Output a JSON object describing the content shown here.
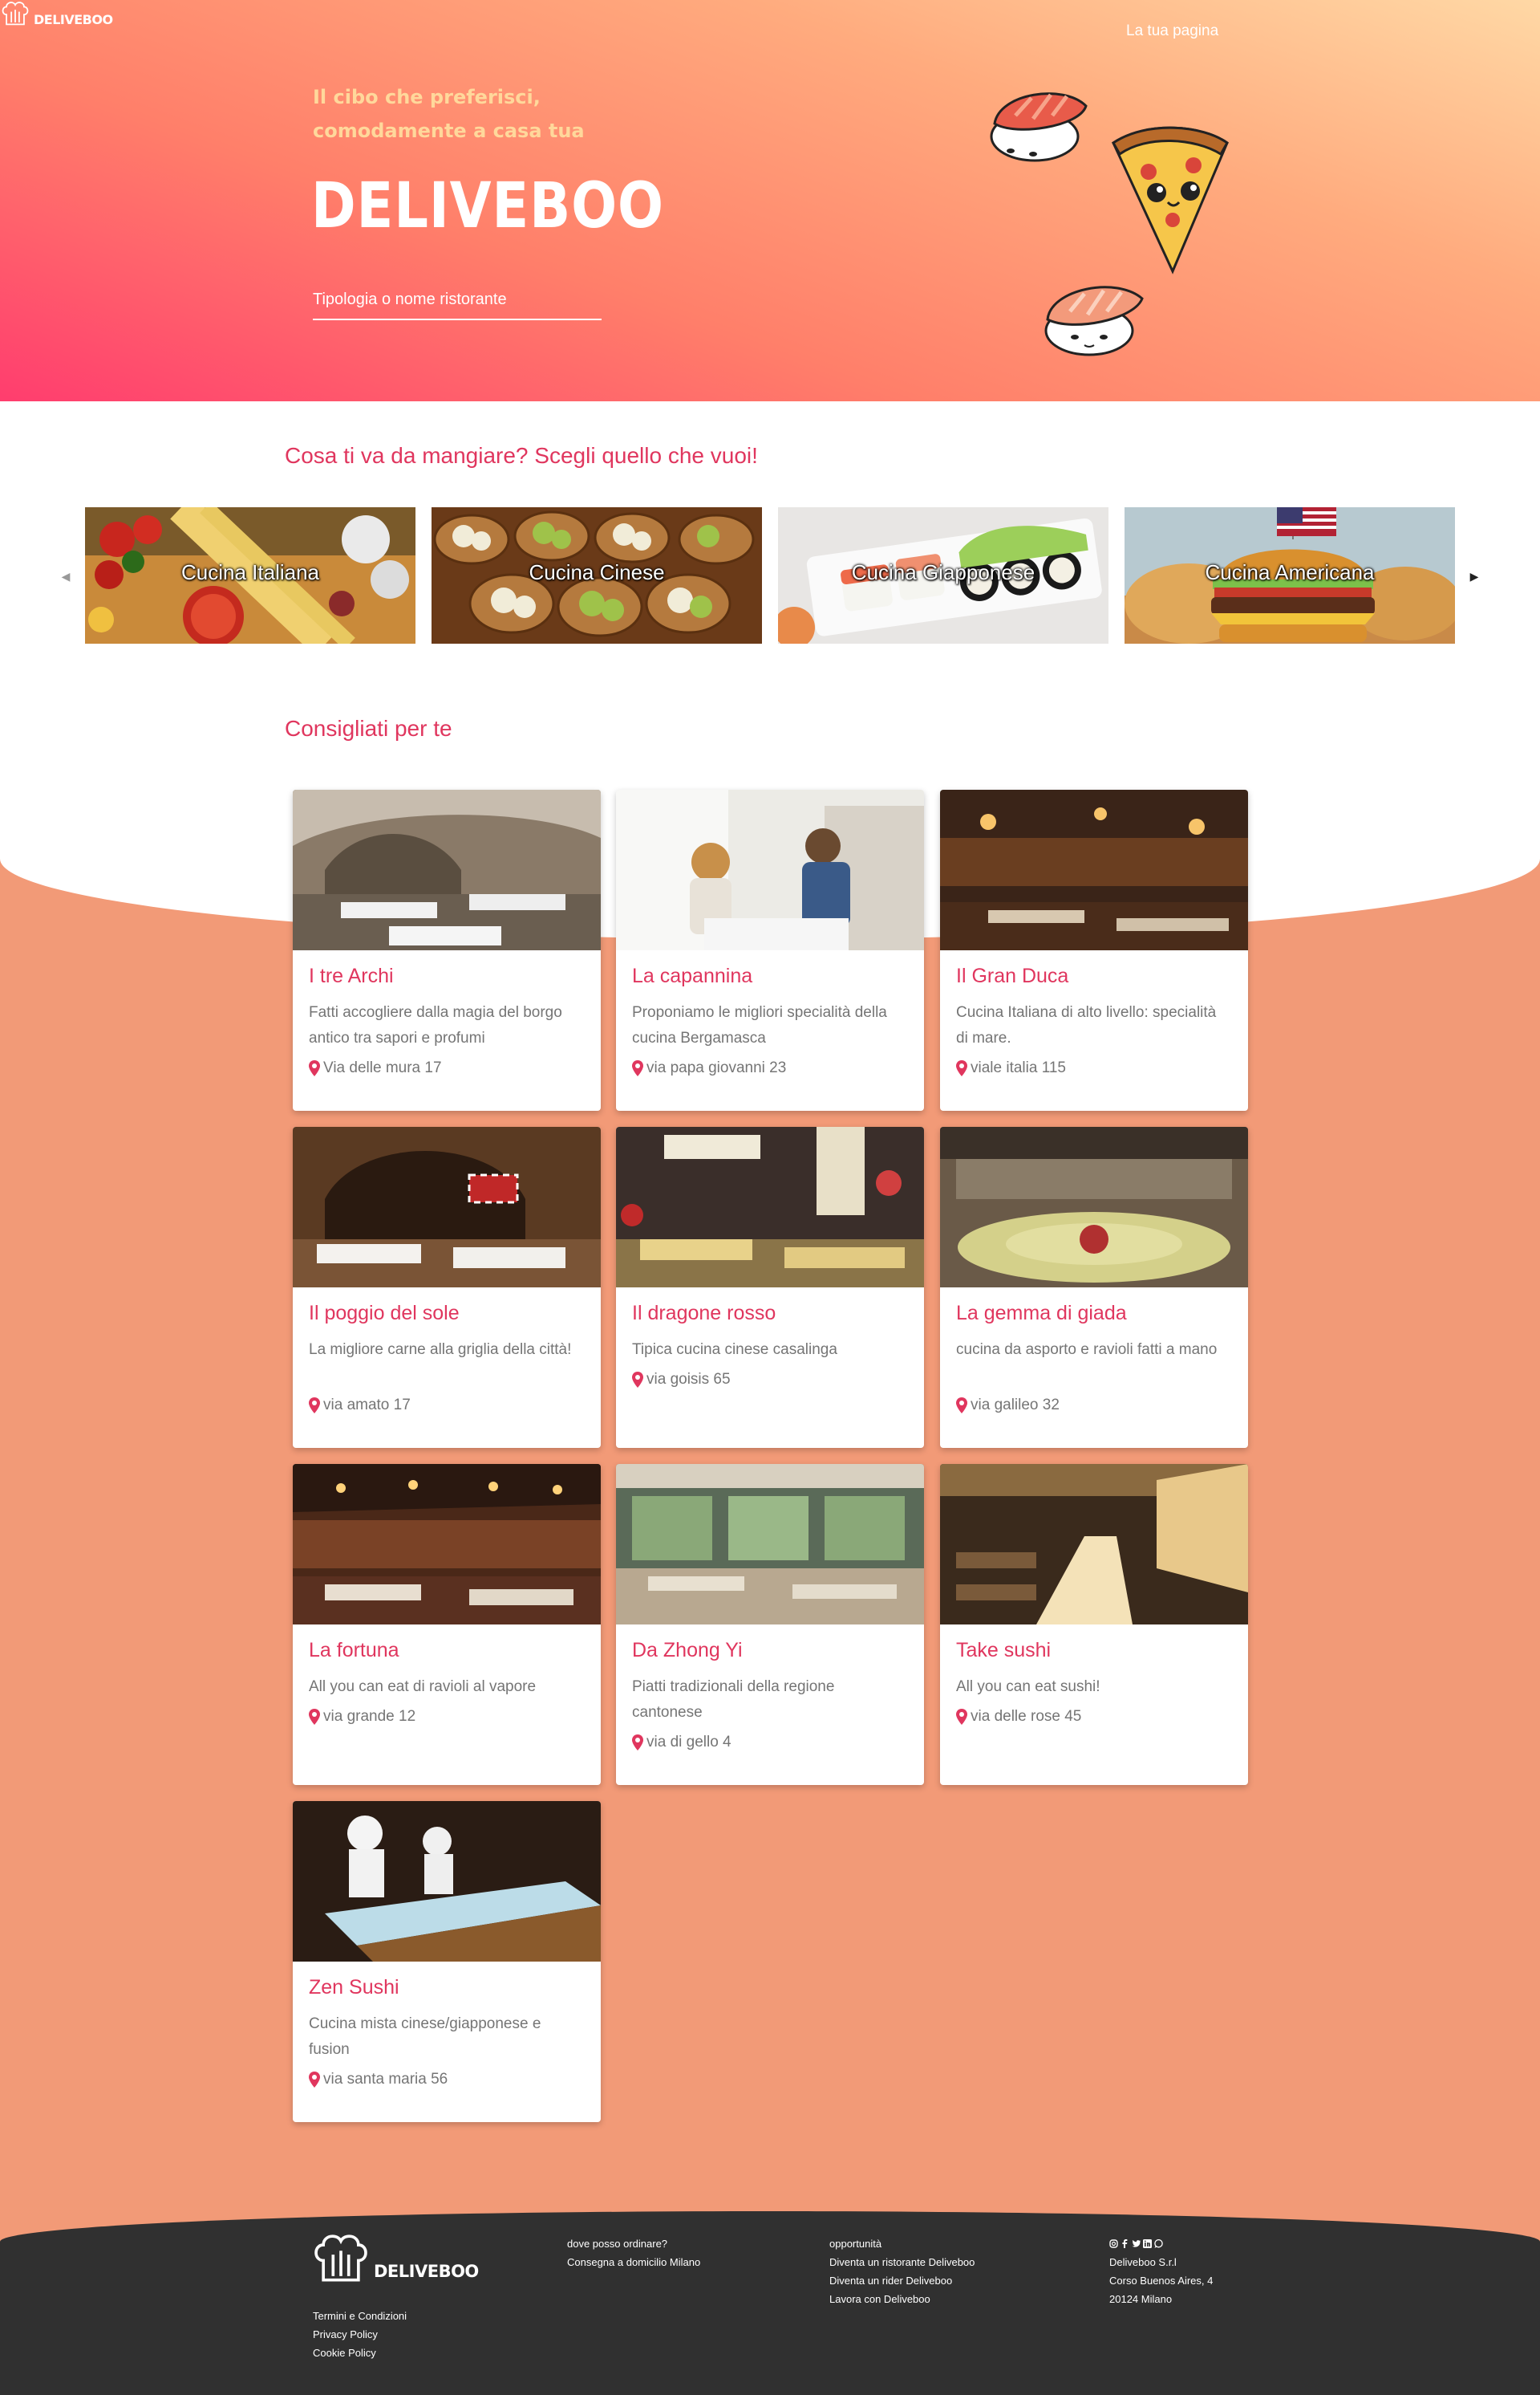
{
  "header": {
    "logo_text": "DELIVEBOO",
    "tagline": "Il cibo che preferisci, comodamente a casa tua",
    "title": "DELIVEBOO",
    "nav_link": "La tua pagina",
    "search_placeholder": "Tipologia o nome ristorante"
  },
  "sections": {
    "categories_title": "Cosa ti va da mangiare? Scegli quello che vuoi!",
    "recommended_title": "Consigliati per te"
  },
  "categories": [
    {
      "label": "Cucina Italiana"
    },
    {
      "label": "Cucina Cinese"
    },
    {
      "label": "Cucina Giapponese"
    },
    {
      "label": "Cucina Americana"
    }
  ],
  "restaurants": [
    {
      "name": "I tre Archi",
      "description": "Fatti accogliere dalla magia del borgo antico tra sapori e profumi",
      "address": "Via delle mura 17"
    },
    {
      "name": "La capannina",
      "description": "Proponiamo le migliori specialità della cucina Bergamasca",
      "address": "via papa giovanni 23"
    },
    {
      "name": "Il Gran Duca",
      "description": "Cucina Italiana di alto livello: specialità di mare.",
      "address": "viale italia 115"
    },
    {
      "name": "Il poggio del sole",
      "description": "La migliore carne alla griglia della città!",
      "address": "via amato 17"
    },
    {
      "name": "Il dragone rosso",
      "description": "Tipica cucina cinese casalinga",
      "address": "via goisis 65"
    },
    {
      "name": "La gemma di giada",
      "description": "cucina da asporto e ravioli fatti a mano",
      "address": "via galileo 32"
    },
    {
      "name": "La fortuna",
      "description": "All you can eat di ravioli al vapore",
      "address": "via grande 12"
    },
    {
      "name": "Da Zhong Yi",
      "description": "Piatti tradizionali della regione cantonese",
      "address": "via di gello 4"
    },
    {
      "name": "Take sushi",
      "description": "All you can eat sushi!",
      "address": "via delle rose 45"
    },
    {
      "name": "Zen Sushi",
      "description": "Cucina mista cinese/giapponese e fusion",
      "address": "via santa maria 56"
    }
  ],
  "footer": {
    "logo_text": "DELIVEBOO",
    "links": [
      "Termini e Condizioni",
      "Privacy Policy",
      "Cookie Policy"
    ],
    "col1": {
      "title": "dove posso ordinare?",
      "items": [
        "Consegna a domicilio Milano"
      ]
    },
    "col2": {
      "title": "opportunità",
      "items": [
        "Diventa un ristorante Deliveboo",
        "Diventa un rider Deliveboo",
        "Lavora con Deliveboo"
      ]
    },
    "col3": {
      "social": [
        "instagram-icon",
        "facebook-icon",
        "twitter-icon",
        "linkedin-icon",
        "whatsapp-icon"
      ],
      "items": [
        "Deliveboo S.r.l",
        "Corso Buenos Aires, 4",
        "20124 Milano"
      ]
    }
  },
  "colors": {
    "accent": "#e0365e",
    "background": "#f29a77",
    "footer": "#303030",
    "tagline": "#ffd89b"
  }
}
